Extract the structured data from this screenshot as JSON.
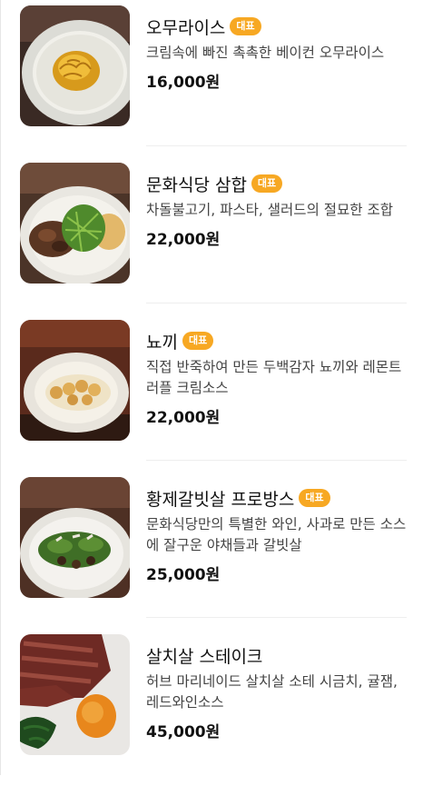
{
  "menu": {
    "badge_label": "대표",
    "items": [
      {
        "name": "오무라이스",
        "badge": true,
        "description": "크림속에 빠진 촉촉한 베이컨 오무라이스",
        "price": "16,000원",
        "image": "omurice-plate"
      },
      {
        "name": "문화식당 삼합",
        "badge": true,
        "description": "차돌불고기, 파스타, 샐러드의 절묘한 조합",
        "price": "22,000원",
        "image": "samhap-plate"
      },
      {
        "name": "뇨끼",
        "badge": true,
        "description": "직접 반죽하여 만든 두백감자 뇨끼와 레몬트러플 크림소스",
        "price": "22,000원",
        "image": "gnocchi-plate"
      },
      {
        "name": "황제갈빗살 프로방스",
        "badge": true,
        "description": "문화식당만의 특별한 와인, 사과로 만든 소스에 잘구운 야채들과 갈빗살",
        "price": "25,000원",
        "image": "galbi-plate"
      },
      {
        "name": "살치살 스테이크",
        "badge": false,
        "description": "허브 마리네이드 살치살 소테 시금치, 귤잼, 레드와인소스",
        "price": "45,000원",
        "image": "steak-plate"
      }
    ]
  },
  "colors": {
    "badge": "#f7a823",
    "text": "#111111",
    "description": "#444444"
  }
}
